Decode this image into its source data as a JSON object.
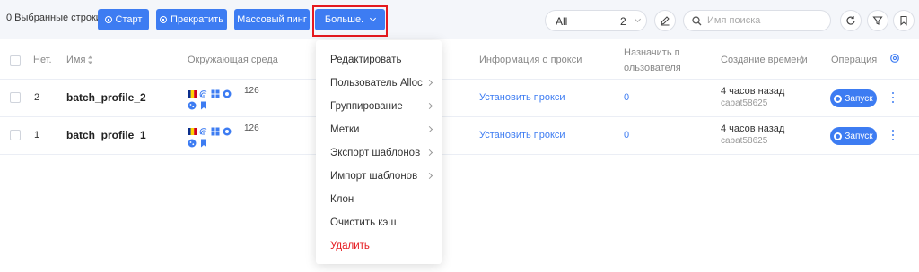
{
  "toolbar": {
    "selected_rows": "0 Выбранные строки",
    "start_label": "Старт",
    "stop_label": "Прекратить",
    "mass_ping_label": "Массовый пинг",
    "more_label": "Больше.",
    "filter_left": "All",
    "filter_right": "2",
    "search_placeholder": "Имя поиска"
  },
  "table": {
    "headers": {
      "num": "Нет.",
      "name": "Имя",
      "env": "Окружающая среда",
      "proxy": "Информация о прокси",
      "assign_user": "Назначить пользователя",
      "created": "Создание времени",
      "operation": "Операция"
    },
    "rows": [
      {
        "num": "2",
        "name": "batch_profile_2",
        "env_count": "126",
        "proxy": "Установить прокси",
        "assign": "0",
        "created": "4 часов назад",
        "creator": "cabat58625",
        "action": "Запуск"
      },
      {
        "num": "1",
        "name": "batch_profile_1",
        "env_count": "126",
        "proxy": "Установить прокси",
        "assign": "0",
        "created": "4 часов назад",
        "creator": "cabat58625",
        "action": "Запуск"
      }
    ]
  },
  "menu": {
    "items": [
      "Редактировать",
      "Пользователь Alloc",
      "Группирование",
      "Метки",
      "Экспорт шаблонов",
      "Импорт шаблонов",
      "Клон",
      "Очистить кэш",
      "Удалить"
    ]
  },
  "colors": {
    "primary": "#3d7cf2",
    "danger": "#e5191e",
    "highlight_box": "#e5191e"
  },
  "icons": {
    "start": "play-circle-icon",
    "stop": "stop-circle-icon",
    "more": "chevron-down-icon",
    "edit": "pencil-icon",
    "search": "search-icon",
    "refresh": "refresh-icon",
    "filter": "filter-icon",
    "bookmark": "bookmark-icon",
    "settings": "gear-icon",
    "sort": "sort-icon",
    "kebab": "more-vertical-icon"
  }
}
